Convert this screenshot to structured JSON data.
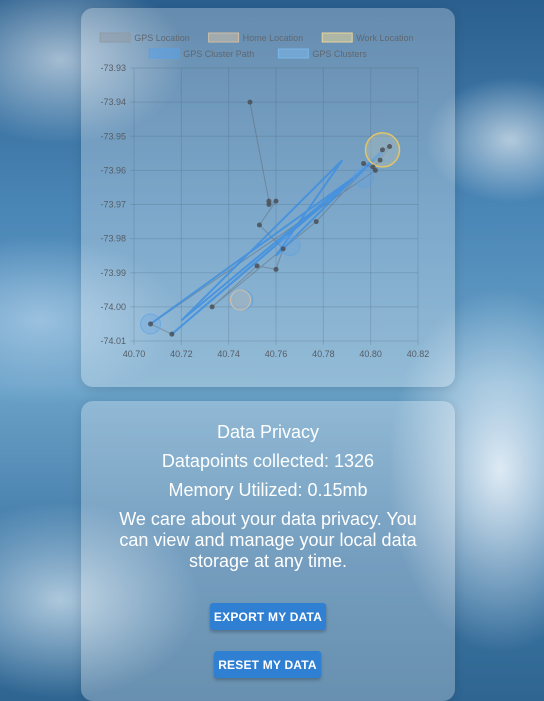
{
  "chart_data": {
    "type": "scatter",
    "xlim": [
      40.7,
      40.82
    ],
    "ylim": [
      -74.01,
      -73.93
    ],
    "x_ticks": [
      "40.70",
      "40.72",
      "40.74",
      "40.76",
      "40.78",
      "40.80",
      "40.82"
    ],
    "y_ticks": [
      "-73.93",
      "-73.94",
      "-73.95",
      "-73.96",
      "-73.97",
      "-73.98",
      "-73.99",
      "-74.00",
      "-74.01"
    ],
    "grid": true,
    "legend_position": "top",
    "legend": [
      {
        "label": "GPS Location",
        "swatch": "#8f9ba6"
      },
      {
        "label": "Home Location",
        "swatch": "#cfbfa8"
      },
      {
        "label": "Work Location",
        "swatch": "#e8d59a"
      },
      {
        "label": "GPS Cluster Path",
        "swatch": "#5aa0e6"
      },
      {
        "label": "GPS Clusters",
        "swatch": "#7ab6ea"
      }
    ],
    "series": [
      {
        "name": "GPS Location",
        "color": "#4a5057",
        "points": [
          [
            40.749,
            -73.94
          ],
          [
            40.757,
            -73.969
          ],
          [
            40.757,
            -73.97
          ],
          [
            40.76,
            -73.969
          ],
          [
            40.753,
            -73.976
          ],
          [
            40.763,
            -73.983
          ],
          [
            40.76,
            -73.989
          ],
          [
            40.752,
            -73.988
          ],
          [
            40.733,
            -74.0
          ],
          [
            40.777,
            -73.975
          ],
          [
            40.805,
            -73.954
          ],
          [
            40.808,
            -73.953
          ],
          [
            40.804,
            -73.957
          ],
          [
            40.801,
            -73.959
          ],
          [
            40.797,
            -73.958
          ],
          [
            40.802,
            -73.96
          ],
          [
            40.707,
            -74.005
          ],
          [
            40.716,
            -74.008
          ]
        ]
      },
      {
        "name": "GPS Cluster Path",
        "color": "#3f8fe0",
        "points": [
          [
            40.707,
            -74.005
          ],
          [
            40.797,
            -73.96
          ],
          [
            40.716,
            -74.008
          ],
          [
            40.805,
            -73.955
          ],
          [
            40.72,
            -74.004
          ],
          [
            40.788,
            -73.957
          ],
          [
            40.76,
            -73.985
          ],
          [
            40.805,
            -73.954
          ]
        ]
      },
      {
        "name": "GPS Clusters",
        "color": "#5aa0e6",
        "points": [
          [
            40.707,
            -74.005
          ],
          [
            40.746,
            -73.998
          ],
          [
            40.766,
            -73.982
          ],
          [
            40.797,
            -73.962
          ],
          [
            40.805,
            -73.954
          ]
        ]
      }
    ],
    "home_location": [
      40.745,
      -73.998
    ],
    "work_location": [
      40.805,
      -73.954
    ]
  },
  "privacy": {
    "title": "Data Privacy",
    "datapoints_text": "Datapoints collected: 1326",
    "memory_text": "Memory Utilized: 0.15mb",
    "description": "We care about your data privacy. You can view and manage your local data storage at any time.",
    "export_button": "EXPORT MY DATA",
    "reset_button": "RESET MY DATA"
  },
  "colors": {
    "button": "#2f7fd3",
    "card": "rgba(255,255,255,0.28)",
    "text": "#ffffff"
  }
}
